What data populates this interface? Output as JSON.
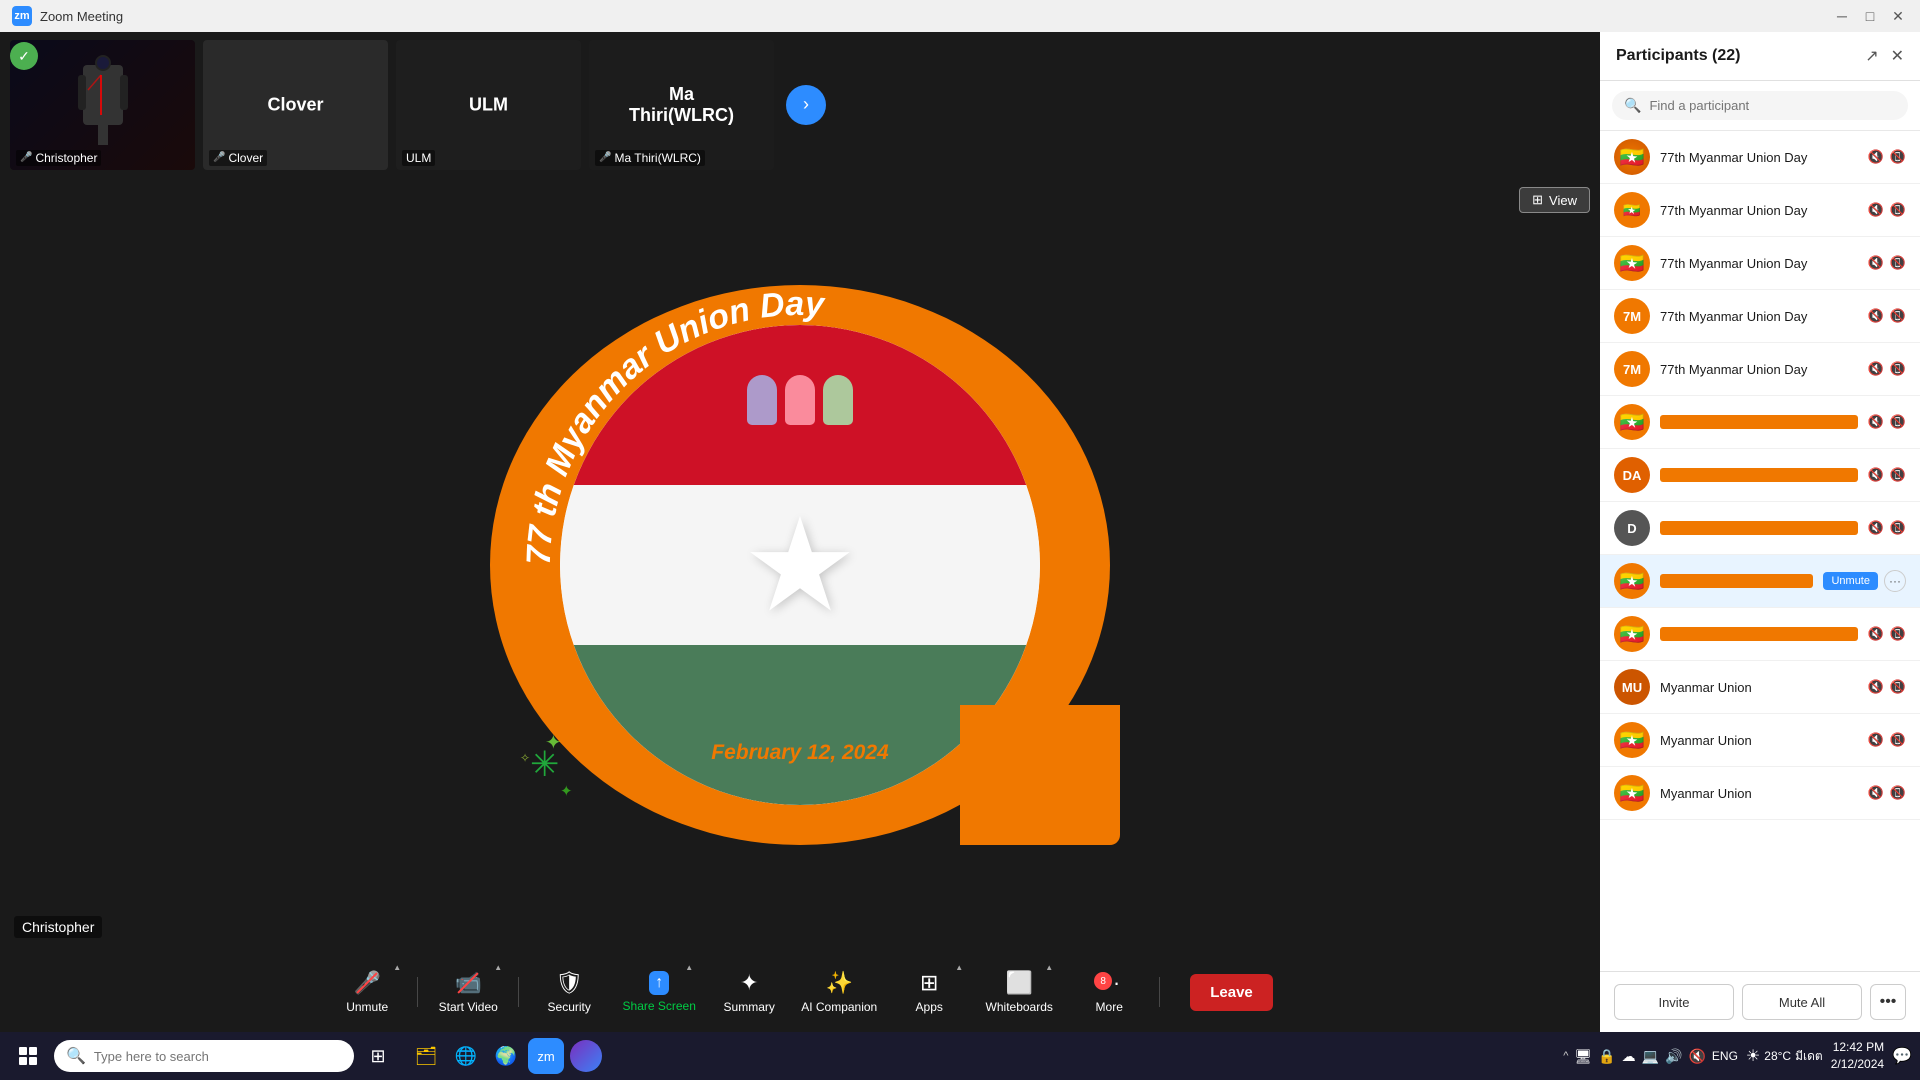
{
  "titleBar": {
    "title": "Zoom Meeting",
    "logoText": "zm",
    "minimizeBtn": "─",
    "maximizeBtn": "□",
    "closeBtn": "✕"
  },
  "participantsStrip": {
    "tiles": [
      {
        "id": "christopher",
        "name": "Christopher",
        "label": "",
        "muted": true,
        "type": "image"
      },
      {
        "id": "clover",
        "name": "Clover",
        "label": "Clover",
        "muted": true,
        "type": "text"
      },
      {
        "id": "ulm",
        "name": "ULM",
        "label": "ULM",
        "muted": false,
        "type": "text"
      },
      {
        "id": "mathiri",
        "name": "Ma Thiri(WLRC)",
        "label": "Ma Thiri(WLRC)",
        "muted": true,
        "type": "text"
      }
    ],
    "nextBtn": "›"
  },
  "mainVideo": {
    "posterTitle1": "77 th Myanmar Union Day",
    "posterTitle2": "77th Myanmar Union Day",
    "date": "February 12, 2024",
    "viewBtn": "View",
    "speakerLabel": "Christopher"
  },
  "toolbar": {
    "buttons": [
      {
        "id": "unmute",
        "icon": "🎤",
        "label": "Unmute",
        "hasCaret": true,
        "muted": true,
        "active": false
      },
      {
        "id": "startVideo",
        "icon": "📹",
        "label": "Start Video",
        "hasCaret": true,
        "muted": true,
        "active": false
      },
      {
        "id": "security",
        "icon": "🛡",
        "label": "Security",
        "hasCaret": false,
        "active": false
      },
      {
        "id": "shareScreen",
        "icon": "↑",
        "label": "Share Screen",
        "hasCaret": true,
        "active": true
      },
      {
        "id": "summary",
        "icon": "✦",
        "label": "Summary",
        "hasCaret": false,
        "active": false
      },
      {
        "id": "aiCompanion",
        "icon": "✨",
        "label": "AI Companion",
        "hasCaret": false,
        "active": false
      },
      {
        "id": "apps",
        "icon": "⊞",
        "label": "Apps",
        "hasCaret": true,
        "active": false
      },
      {
        "id": "whiteboards",
        "icon": "⬜",
        "label": "Whiteboards",
        "hasCaret": true,
        "active": false
      },
      {
        "id": "more",
        "icon": "•••",
        "label": "More",
        "badge": "8",
        "hasCaret": false,
        "active": false
      }
    ],
    "leaveBtn": "Leave"
  },
  "participantsPanel": {
    "title": "Participants (22)",
    "searchPlaceholder": "Find a participant",
    "participants": [
      {
        "id": "p1",
        "name": "77th Myanmar Union Day",
        "avatarType": "img",
        "avatarColor": "#f07800",
        "initials": "7M",
        "muted": true,
        "videoOff": true
      },
      {
        "id": "p2",
        "name": "77th Myanmar Union Day",
        "avatarType": "img",
        "avatarColor": "#f07800",
        "initials": "7M",
        "muted": true,
        "videoOff": true
      },
      {
        "id": "p3",
        "name": "77th Myanmar Union Day",
        "avatarType": "img",
        "avatarColor": "#f07800",
        "initials": "7M",
        "muted": true,
        "videoOff": true
      },
      {
        "id": "p4",
        "name": "77th Myanmar Union Day",
        "avatarType": "badge",
        "avatarColor": "#f07800",
        "initials": "7M",
        "muted": true,
        "videoOff": true
      },
      {
        "id": "p5",
        "name": "77th Myanmar Union Day",
        "avatarType": "badge",
        "avatarColor": "#f07800",
        "initials": "7M",
        "muted": true,
        "videoOff": true
      },
      {
        "id": "p6",
        "name": "",
        "avatarType": "img2",
        "avatarColor": "#f07800",
        "initials": "",
        "muted": true,
        "videoOff": true,
        "nameBar": true
      },
      {
        "id": "p7",
        "name": "",
        "avatarType": "badge2",
        "avatarColor": "#e06000",
        "initials": "DA",
        "muted": true,
        "videoOff": true,
        "nameBar": true
      },
      {
        "id": "p8",
        "name": "",
        "avatarType": "letter",
        "avatarColor": "#555",
        "initials": "D",
        "muted": true,
        "videoOff": true,
        "nameBar": true
      },
      {
        "id": "p9",
        "name": "",
        "avatarType": "img3",
        "avatarColor": "#f07800",
        "initials": "",
        "muted": false,
        "videoOff": false,
        "nameBar": true,
        "highlighted": true,
        "hasUnmuteBtn": true
      },
      {
        "id": "p10",
        "name": "",
        "avatarType": "img4",
        "avatarColor": "#f07800",
        "initials": "",
        "muted": true,
        "videoOff": true,
        "nameBar": true
      },
      {
        "id": "p11",
        "name": "Myanmar Union",
        "avatarType": "badge3",
        "avatarColor": "#cc5500",
        "initials": "MU",
        "muted": true,
        "videoOff": true
      },
      {
        "id": "p12",
        "name": "Myanmar Union",
        "avatarType": "img5",
        "avatarColor": "#f07800",
        "initials": "",
        "muted": true,
        "videoOff": true
      },
      {
        "id": "p13",
        "name": "Myanmar Union",
        "avatarType": "img6",
        "avatarColor": "#f07800",
        "initials": "",
        "muted": true,
        "videoOff": true
      }
    ],
    "footerBtns": {
      "invite": "Invite",
      "muteAll": "Mute All",
      "more": "•••"
    }
  },
  "taskbar": {
    "searchPlaceholder": "Type here to search",
    "systemInfo": {
      "weather": "28°C",
      "weatherUnit": "มีเดต",
      "time": "12:42 PM",
      "date": "2/12/2024",
      "language": "ENG"
    }
  }
}
